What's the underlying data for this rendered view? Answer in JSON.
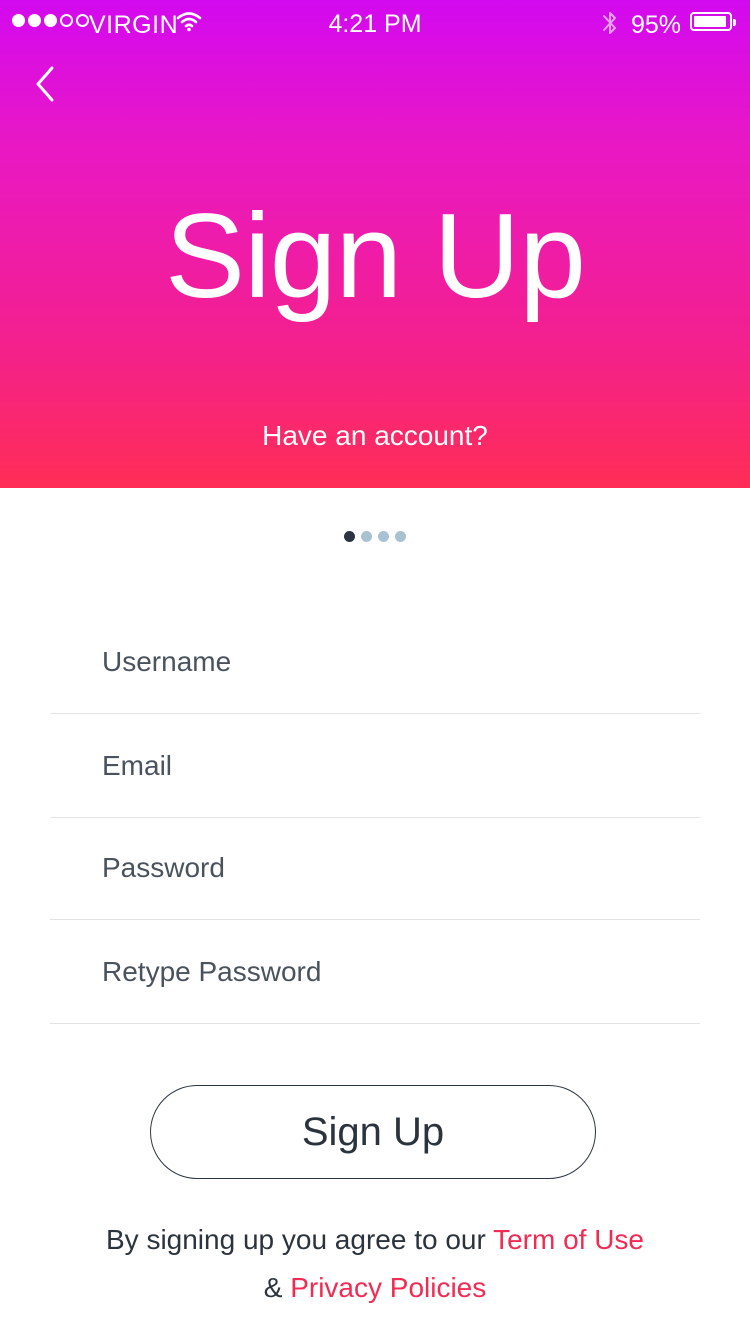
{
  "status_bar": {
    "carrier": "VIRGIN",
    "time": "4:21 PM",
    "battery_percent": "95%",
    "battery_level": 0.95,
    "signal_bars_filled": 3,
    "signal_bars_total": 5,
    "icons": [
      "wifi-icon",
      "bluetooth-icon",
      "battery-icon"
    ]
  },
  "header": {
    "back_icon": "chevron-left-icon",
    "title": "Sign Up",
    "have_account": "Have an account?",
    "gradient_top": "#d309f0",
    "gradient_bottom": "#ff2d55"
  },
  "pager": {
    "total": 4,
    "active": 1
  },
  "form": {
    "username": {
      "placeholder": "Username",
      "value": ""
    },
    "email": {
      "placeholder": "Email",
      "value": ""
    },
    "password": {
      "placeholder": "Password",
      "value": ""
    },
    "retype_password": {
      "placeholder": "Retype Password",
      "value": ""
    }
  },
  "signup_button": {
    "label": "Sign Up"
  },
  "terms": {
    "prefix": "By signing up you agree to our ",
    "terms_link": "Term of Use",
    "ampersand": "& ",
    "privacy_link": "Privacy Policies",
    "link_color": "#f02c55"
  }
}
